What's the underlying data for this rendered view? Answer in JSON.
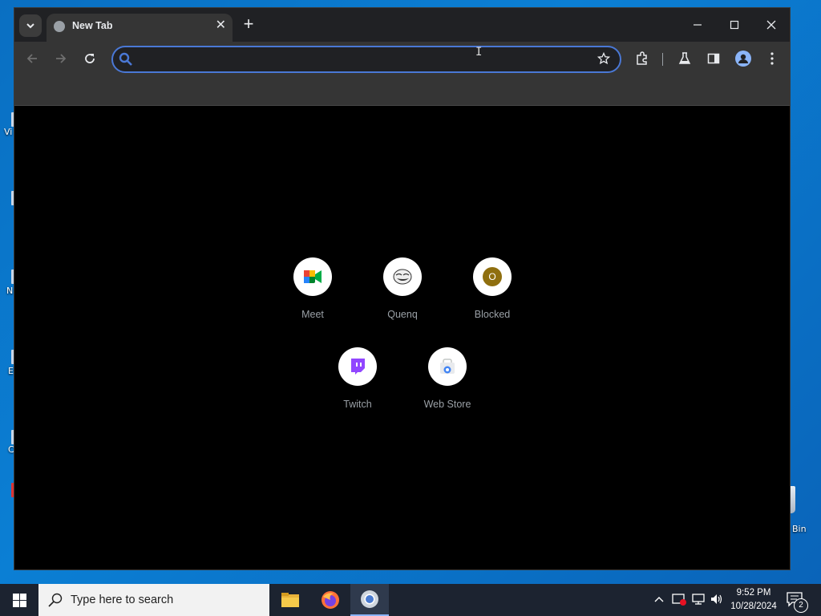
{
  "desktop": {
    "recycle_bin_label": "Bin",
    "left_labels": [
      "Vi",
      "N",
      "E",
      "C"
    ]
  },
  "browser": {
    "tab": {
      "title": "New Tab"
    },
    "omnibox": {
      "value": "",
      "placeholder": ""
    },
    "shortcuts": [
      {
        "label": "Meet",
        "icon": "meet-icon"
      },
      {
        "label": "Quenq",
        "icon": "troll-face-icon"
      },
      {
        "label": "Blocked",
        "icon": "letter-o-icon",
        "letter": "O"
      },
      {
        "label": "Twitch",
        "icon": "twitch-icon"
      },
      {
        "label": "Web Store",
        "icon": "web-store-icon"
      }
    ],
    "colors": {
      "accent": "#4a78d6",
      "titlebar": "#202124",
      "toolbar": "#353535"
    }
  },
  "taskbar": {
    "search_placeholder": "Type here to search",
    "clock_time": "9:52 PM",
    "clock_date": "10/28/2024",
    "notification_count": "2"
  }
}
